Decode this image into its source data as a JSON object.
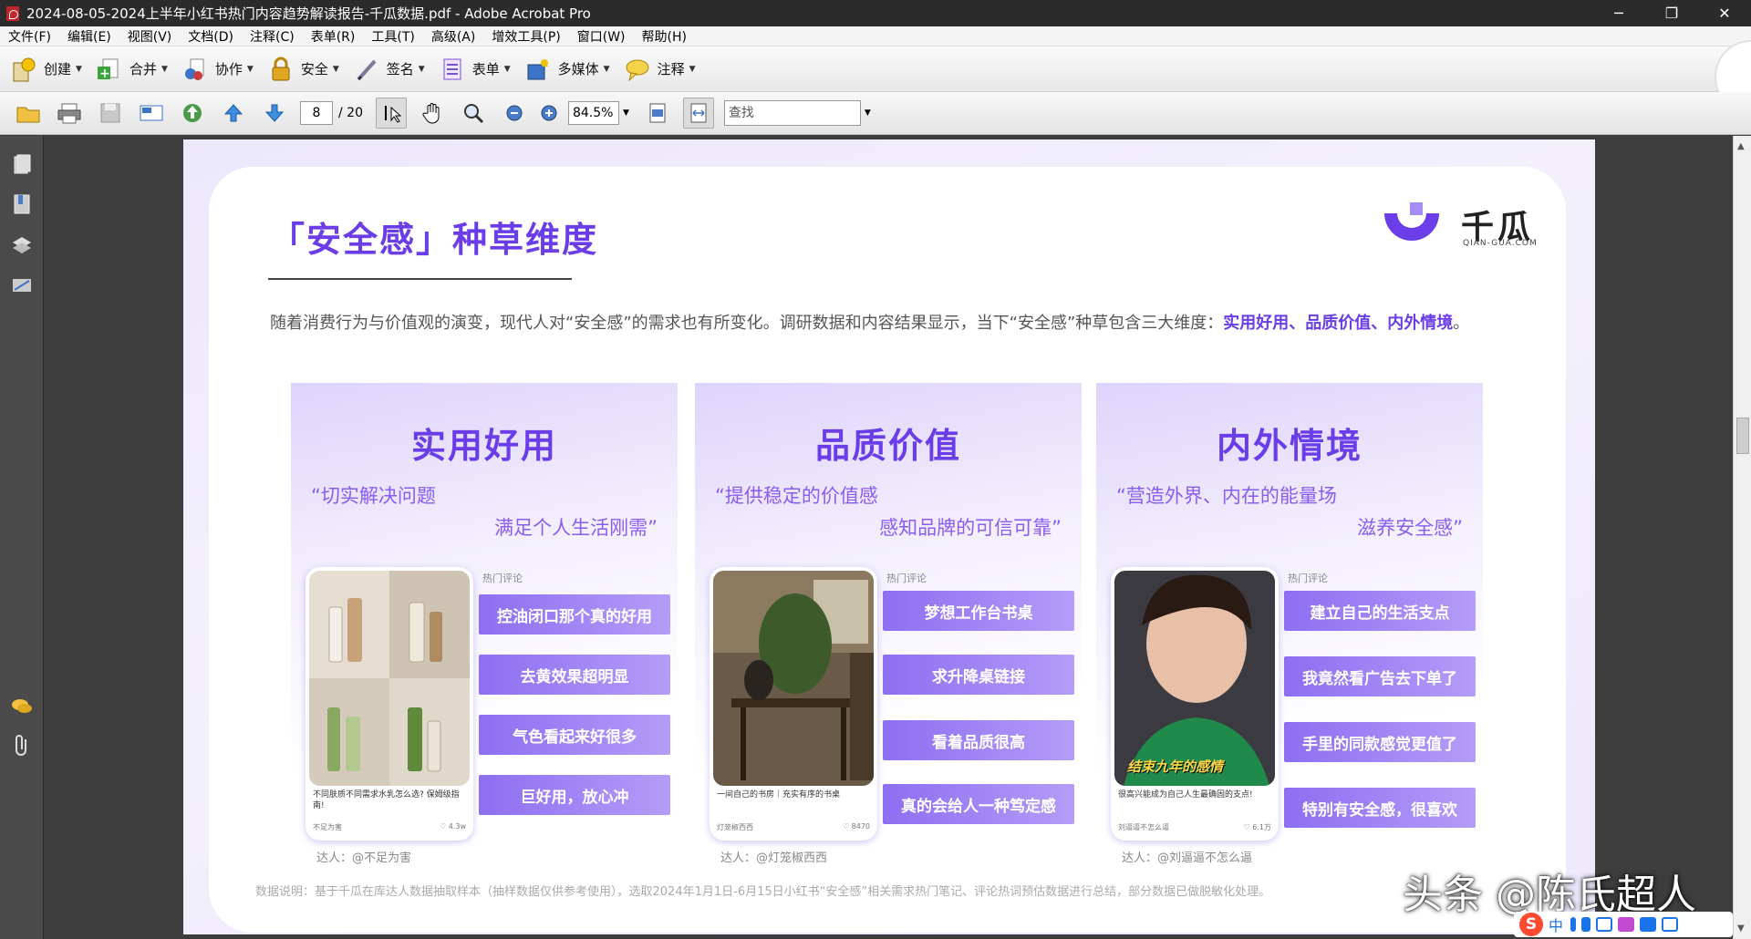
{
  "window": {
    "title": "2024-08-05-2024上半年小红书热门内容趋势解读报告-千瓜数据.pdf - Adobe Acrobat Pro",
    "minimize": "─",
    "restore": "❐",
    "close": "✕"
  },
  "menu": [
    "文件(F)",
    "编辑(E)",
    "视图(V)",
    "文档(D)",
    "注释(C)",
    "表单(R)",
    "工具(T)",
    "高级(A)",
    "增效工具(P)",
    "窗口(W)",
    "帮助(H)"
  ],
  "toolbar1": {
    "create": "创建",
    "combine": "合并",
    "collaborate": "协作",
    "secure": "安全",
    "sign": "签名",
    "forms": "表单",
    "multimedia": "多媒体",
    "comment": "注释"
  },
  "toolbar2": {
    "page_current": "8",
    "page_total": "/ 20",
    "zoom": "84.5%",
    "search_placeholder": "查找"
  },
  "page": {
    "title": "「安全感」种草维度",
    "logo_text": "千瓜",
    "logo_sub": "QIAN-GUA.COM",
    "intro_plain": "随着消费行为与价值观的演变，现代人对“安全感”的需求也有所变化。调研数据和内容结果显示，当下“安全感”种草包含三大维度：",
    "intro_highlight": "实用好用、品质价值、内外情境",
    "intro_end": "。",
    "hot_label": "热门评论",
    "columns": [
      {
        "title": "实用好用",
        "quote1": "“切实解决问题",
        "quote2": "满足个人生活刚需”",
        "caption": "不同肤质不同需求水乳怎么选? 保姆级指南!",
        "author": "不足为害",
        "likes": "4.3w",
        "comments": [
          "控油闭口那个真的好用",
          "去黄效果超明显",
          "气色看起来好很多",
          "巨好用，放心冲"
        ],
        "daren": "达人：@不足为害"
      },
      {
        "title": "品质价值",
        "quote1": "“提供稳定的价值感",
        "quote2": "感知品牌的可信可靠”",
        "caption": "一间自己的书房｜充实有序的书桌",
        "author": "灯笼椒西西",
        "likes": "8470",
        "comments": [
          "梦想工作台书桌",
          "求升降桌链接",
          "看着品质很高",
          "真的会给人一种笃定感"
        ],
        "daren": "达人：@灯笼椒西西"
      },
      {
        "title": "内外情境",
        "quote1": "“营造外界、内在的能量场",
        "quote2": "滋养安全感”",
        "caption": "很高兴能成为自己人生最确固的支点!",
        "overlay": "结束九年的感情",
        "author": "刘逼逼不怎么逼",
        "likes": "6.1万",
        "comments": [
          "建立自己的生活支点",
          "我竟然看广告去下单了",
          "手里的同款感觉更值了",
          "特别有安全感，很喜欢"
        ],
        "daren": "达人：@刘逼逼不怎么逼"
      }
    ],
    "footnote": "数据说明：基于千瓜在库达人数据抽取样本（抽样数据仅供参考使用），选取2024年1月1日-6月15日小红书“安全感”相关需求热门笔记、评论热词预估数据进行总结，部分数据已做脱敏化处理。"
  },
  "watermark": "头条 @陈氏超人",
  "ime": {
    "logo": "S",
    "mode": "中"
  },
  "colors": {
    "accent": "#6a3de8",
    "comment_bg": "#9b7ef3",
    "titlebar": "#2b2b2b"
  }
}
